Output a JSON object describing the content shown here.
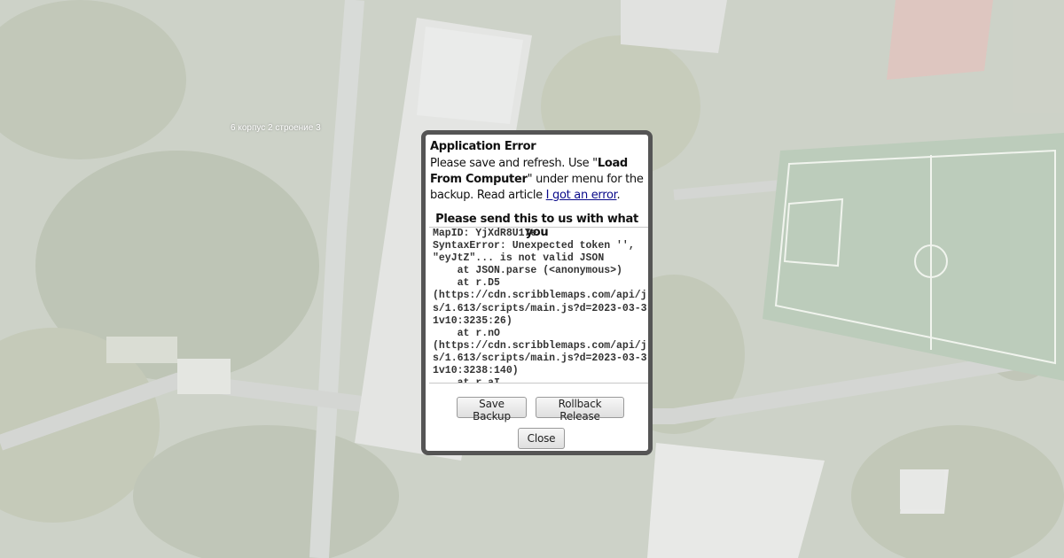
{
  "map": {
    "place_label": "6 корпус 2 строение 3"
  },
  "dialog": {
    "title": "Application Error",
    "message_part1": "Please save and refresh. Use \"",
    "message_bold": "Load From Computer",
    "message_part2": "\" under menu for the backup. Read article ",
    "message_link": "I got an error",
    "message_end": ".",
    "send_heading": "Please send this to us with what you",
    "error_log": "MapID: YjXdR8U17e\nSyntaxError: Unexpected token '', \"eyJtZ\"... is not valid JSON\n    at JSON.parse (<anonymous>)\n    at r.D5\n(https://cdn.scribblemaps.com/api/js/1.613/scripts/main.js?d=2023-03-31v10:3235:26)\n    at r.nO\n(https://cdn.scribblemaps.com/api/js/1.613/scripts/main.js?d=2023-03-31v10:3238:140)\n    at r.aI",
    "buttons": {
      "save_backup": "Save Backup",
      "rollback": "Rollback Release",
      "close": "Close"
    }
  },
  "colors": {
    "dialog_border": "#555555",
    "link": "#0a0a8a",
    "overlay": "rgba(255,255,255,0.62)"
  }
}
